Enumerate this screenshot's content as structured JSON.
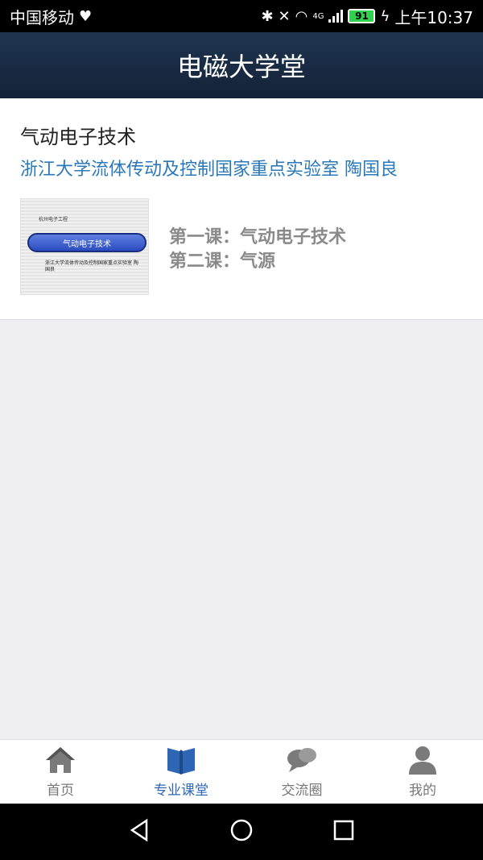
{
  "status_bar": {
    "carrier": "中国移动",
    "network": "4G",
    "battery": "91",
    "time": "上午10:37"
  },
  "header": {
    "title": "电磁大学堂"
  },
  "course": {
    "title": "气动电子技术",
    "author": "浙江大学流体传动及控制国家重点实验室 陶国良",
    "thumbnail": {
      "top_text": "杭州电子工程",
      "pill_text": "气动电子技术",
      "sub_text": "浙江大学流体传动及控制国家重点实验室 陶国良"
    },
    "lessons": [
      "第一课：气动电子技术",
      "第二课：气源"
    ]
  },
  "bottom_nav": {
    "items": [
      {
        "label": "首页",
        "icon": "home-icon"
      },
      {
        "label": "专业课堂",
        "icon": "book-icon",
        "active": true
      },
      {
        "label": "交流圈",
        "icon": "chat-icon"
      },
      {
        "label": "我的",
        "icon": "user-icon"
      }
    ]
  },
  "colors": {
    "header": "#1f3550",
    "accent": "#2e66b5",
    "author": "#2a78b8"
  }
}
